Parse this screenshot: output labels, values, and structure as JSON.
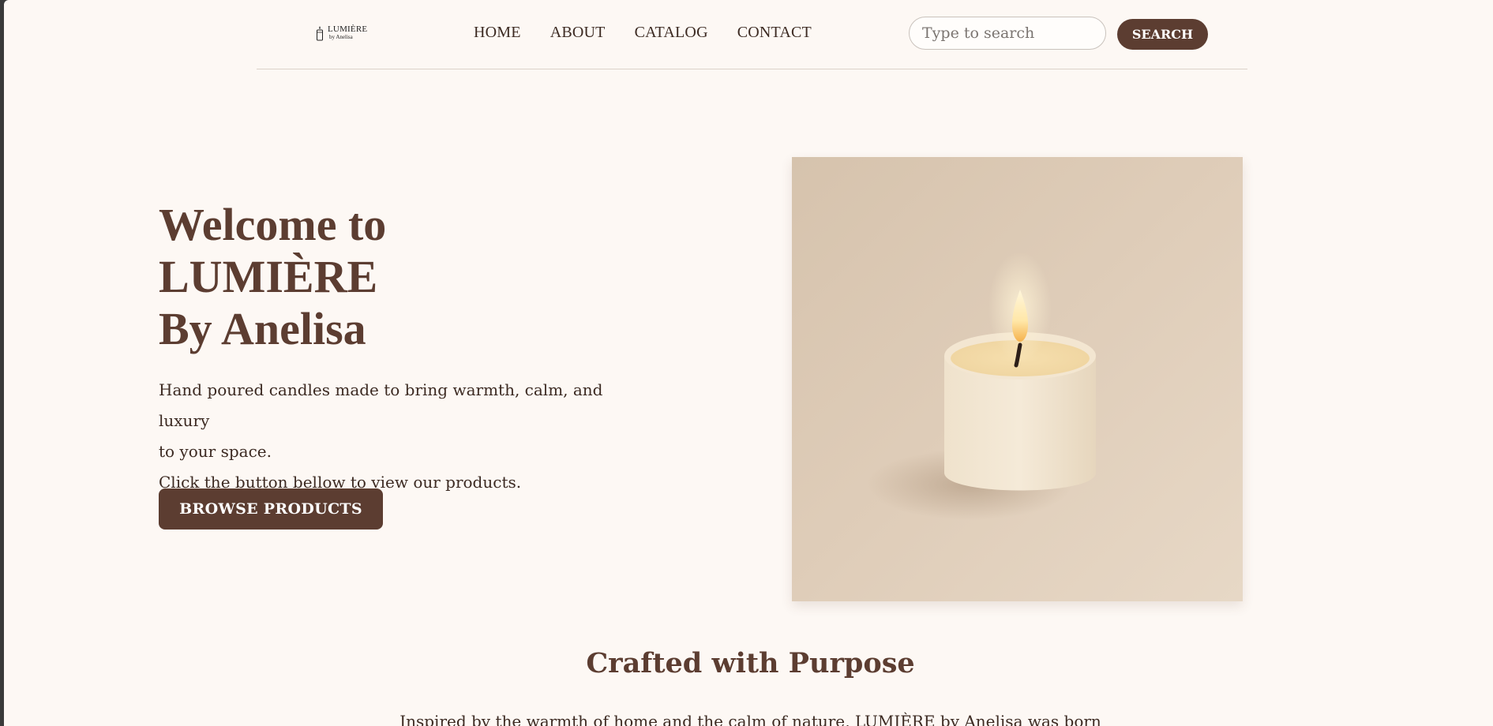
{
  "nav": {
    "logo_line1": "LUMIÈRE",
    "logo_line2": "by Anelisa",
    "links": [
      "HOME",
      "ABOUT",
      "CATALOG",
      "CONTACT"
    ],
    "search_placeholder": "Type to search",
    "search_button": "SEARCH"
  },
  "hero": {
    "title_lines": [
      "Welcome to",
      "LUMIÈRE",
      "By Anelisa"
    ],
    "text_lines": [
      "Hand poured candles made to bring warmth, calm, and luxury",
      "to your space.",
      "Click the button bellow to view our products."
    ],
    "button": "BROWSE PRODUCTS",
    "image_icon": "candle-image"
  },
  "section": {
    "title": "Crafted with Purpose",
    "text": "Inspired by the warmth of home and the calm of nature, LUMIÈRE by Anelisa was born"
  },
  "colors": {
    "brand_brown": "#5c3d31",
    "page_bg": "#fdf8f4",
    "text_dark": "#3c2a22"
  }
}
